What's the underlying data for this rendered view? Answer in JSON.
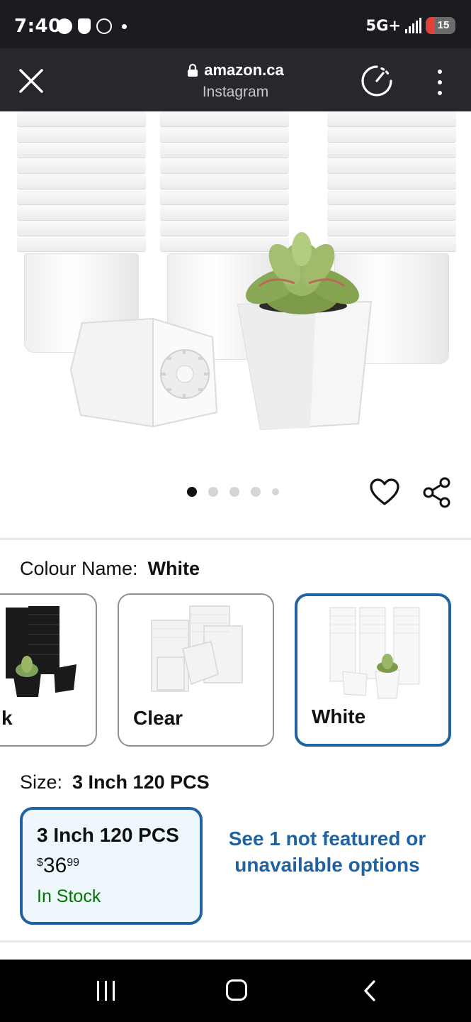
{
  "status_bar": {
    "time": "7:40",
    "network": "5G+",
    "battery": "15",
    "icons": [
      "messenger-icon",
      "shield-alert-icon",
      "fan-icon",
      "notification-dot-icon"
    ]
  },
  "browser": {
    "url": "amazon.ca",
    "source": "Instagram"
  },
  "carousel": {
    "dots": 5,
    "active_index": 0
  },
  "colour": {
    "label": "Colour Name:",
    "selected": "White",
    "options": [
      {
        "label": "k"
      },
      {
        "label": "Clear"
      },
      {
        "label": "White"
      }
    ]
  },
  "size": {
    "label": "Size:",
    "selected": "3 Inch 120 PCS",
    "option": {
      "title": "3 Inch 120 PCS",
      "currency": "$",
      "whole": "36",
      "fraction": "99",
      "stock": "In Stock"
    },
    "more_options": "See 1 not featured or unavailable options"
  },
  "colors": {
    "accent": "#2162a1",
    "selected_bg": "#edf7fc",
    "in_stock": "#007600",
    "status_bar": "#1b1c20",
    "browser_bar": "#26282d"
  }
}
